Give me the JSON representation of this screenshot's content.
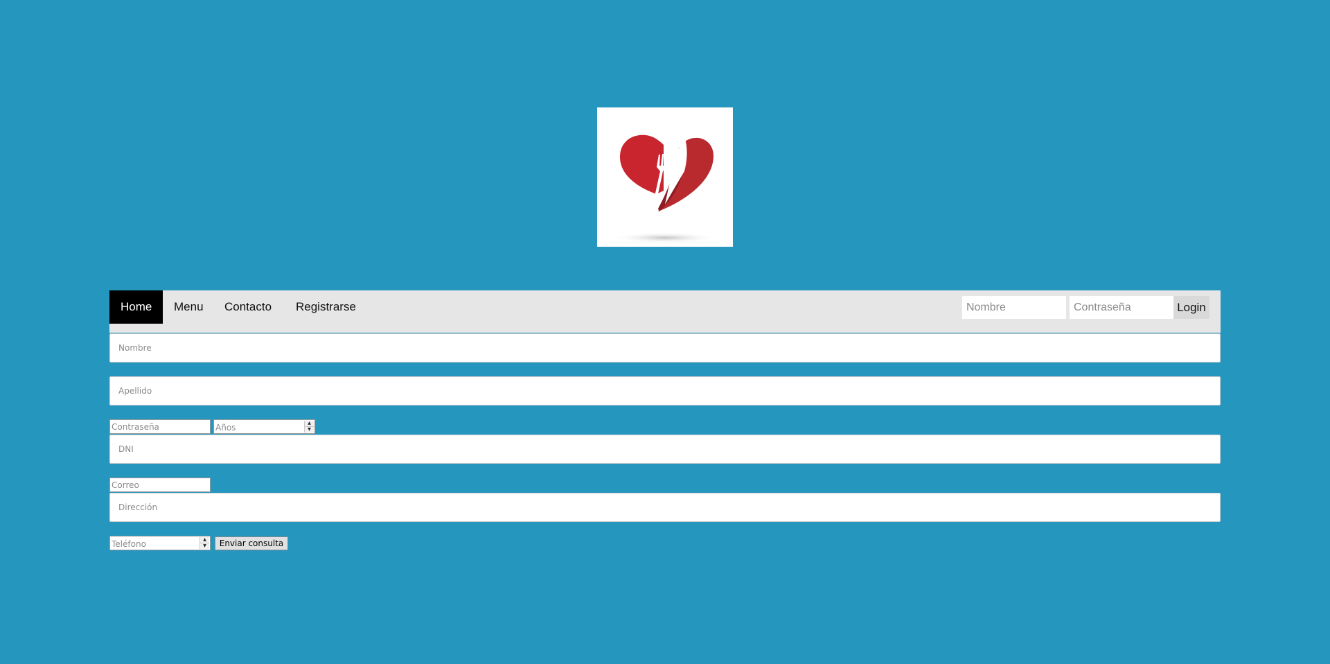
{
  "logo": {
    "icon": "heart-fork-knife-logo",
    "colors": {
      "heart": "#c9252f",
      "utensils": "#ffffff"
    }
  },
  "nav": {
    "items": [
      {
        "label": "Home",
        "active": true
      },
      {
        "label": "Menu",
        "active": false
      },
      {
        "label": "Contacto",
        "active": false
      },
      {
        "label": "Registrarse",
        "active": false
      }
    ],
    "login": {
      "name_placeholder": "Nombre",
      "password_placeholder": "Contraseña",
      "button_label": "Login"
    }
  },
  "form": {
    "nombre_placeholder": "Nombre",
    "apellido_placeholder": "Apellido",
    "contrasena_placeholder": "Contraseña",
    "anios_placeholder": "Años",
    "dni_placeholder": "DNI",
    "correo_placeholder": "Correo",
    "direccion_placeholder": "Dirección",
    "telefono_placeholder": "Teléfono",
    "submit_label": "Enviar consulta"
  },
  "colors": {
    "page_background": "#2596be",
    "navbar_background": "#e6e6e6",
    "nav_active_background": "#000000"
  }
}
